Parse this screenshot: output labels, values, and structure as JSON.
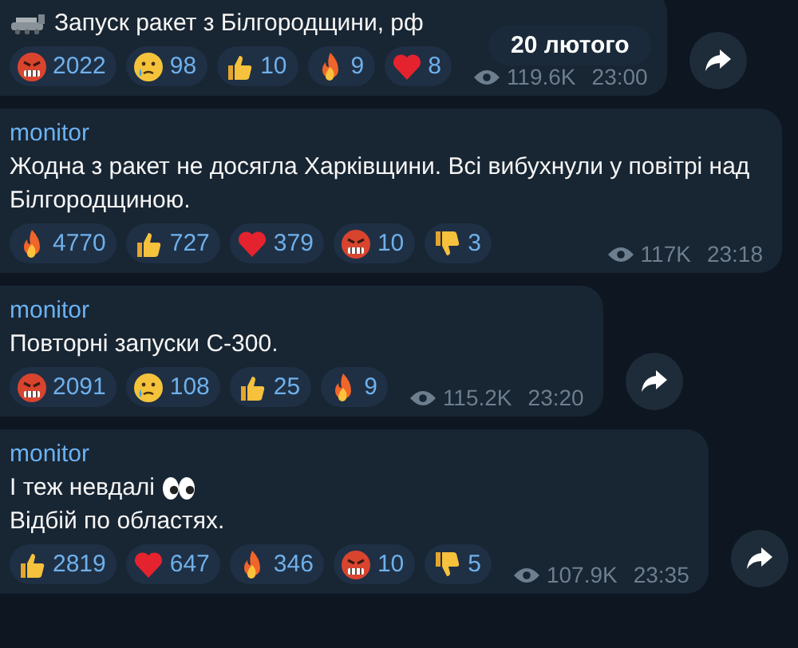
{
  "date_badge": "20 лютого",
  "messages": [
    {
      "lines": [
        {
          "text": "Запуск ракет з Білгородщини, рф",
          "kind": "launcher"
        }
      ],
      "reactions": [
        {
          "kind": "angry",
          "count": "2022"
        },
        {
          "kind": "cry",
          "count": "98"
        },
        {
          "kind": "thumbsup",
          "count": "10"
        },
        {
          "kind": "fire",
          "count": "9"
        },
        {
          "kind": "heart",
          "count": "8"
        }
      ],
      "views": "119.6K",
      "time": "23:00",
      "forward": true
    },
    {
      "sender": "monitor",
      "lines": [
        {
          "text": "Жодна з ракет не досягла Харківщини. Всі вибухнули у повітрі над Білгородщиною.",
          "kind": "plain"
        }
      ],
      "reactions": [
        {
          "kind": "fire",
          "count": "4770"
        },
        {
          "kind": "thumbsup",
          "count": "727"
        },
        {
          "kind": "heart",
          "count": "379"
        },
        {
          "kind": "angry",
          "count": "10"
        },
        {
          "kind": "thumbsdown",
          "count": "3"
        }
      ],
      "views": "117K",
      "time": "23:18",
      "forward": false
    },
    {
      "sender": "monitor",
      "lines": [
        {
          "text": "Повторні запуски С-300.",
          "kind": "plain"
        }
      ],
      "reactions": [
        {
          "kind": "angry",
          "count": "2091"
        },
        {
          "kind": "cry",
          "count": "108"
        },
        {
          "kind": "thumbsup",
          "count": "25"
        },
        {
          "kind": "fire",
          "count": "9"
        }
      ],
      "views": "115.2K",
      "time": "23:20",
      "forward": true
    },
    {
      "sender": "monitor",
      "lines": [
        {
          "text": "І теж невдалі",
          "kind": "eyes"
        },
        {
          "text": "Відбій по областях.",
          "kind": "plain"
        }
      ],
      "reactions": [
        {
          "kind": "thumbsup",
          "count": "2819"
        },
        {
          "kind": "heart",
          "count": "647"
        },
        {
          "kind": "fire",
          "count": "346"
        },
        {
          "kind": "angry",
          "count": "10"
        },
        {
          "kind": "thumbsdown",
          "count": "5"
        }
      ],
      "views": "107.9K",
      "time": "23:35",
      "forward": true
    }
  ]
}
